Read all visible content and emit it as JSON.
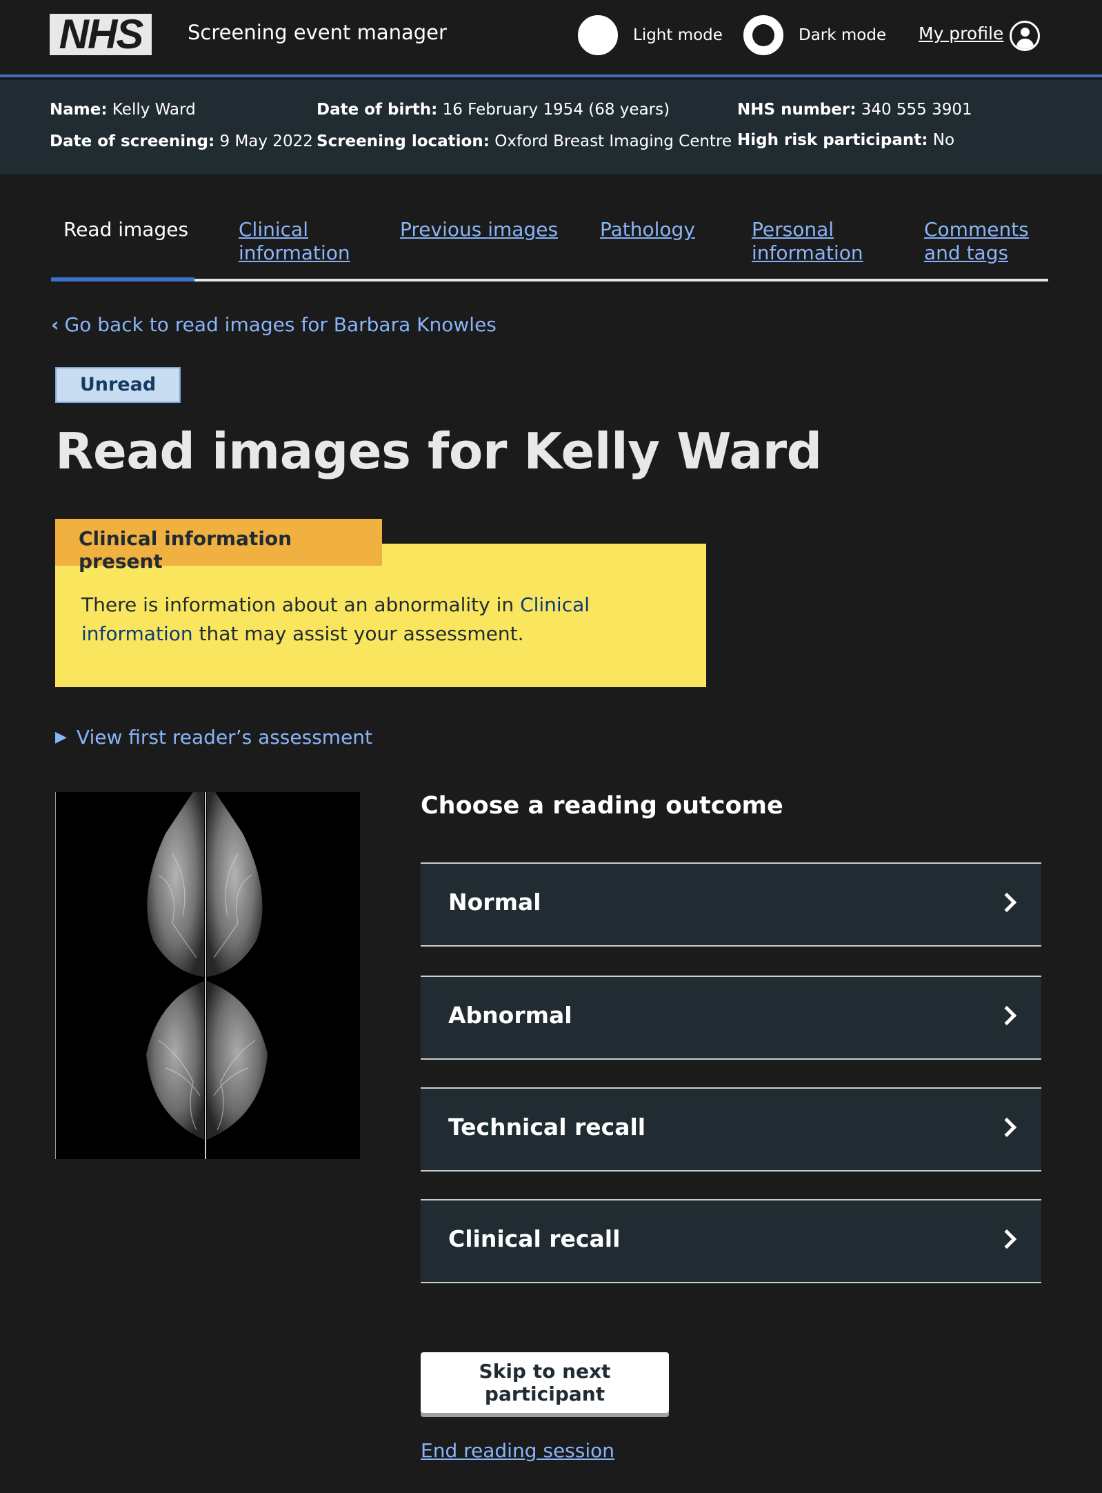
{
  "header": {
    "logo": "NHS",
    "service_name": "Screening event manager",
    "light_mode_label": "Light mode",
    "dark_mode_label": "Dark mode",
    "profile_label": "My profile"
  },
  "participant": {
    "name_label": "Name:",
    "name": "Kelly Ward",
    "screening_date_label": "Date of screening:",
    "screening_date": "9 May 2022",
    "dob_label": "Date of birth:",
    "dob": "16 February 1954 (68 years)",
    "location_label": "Screening location:",
    "location": "Oxford Breast Imaging Centre",
    "nhs_label": "NHS number:",
    "nhs_number": "340 555 3901",
    "risk_label": "High risk participant:",
    "risk": "No"
  },
  "tabs": [
    {
      "label": "Read images",
      "active": true
    },
    {
      "label": "Clinical information"
    },
    {
      "label": "Previous images"
    },
    {
      "label": "Pathology"
    },
    {
      "label": "Personal information"
    },
    {
      "label": "Comments and tags"
    }
  ],
  "back_link": "Go back to read images for Barbara Knowles",
  "status_tag": "Unread",
  "page_title": "Read images for Kelly Ward",
  "callout": {
    "label": "Clinical information present",
    "text_before": "There is information about an abnormality in ",
    "link": "Clinical information",
    "text_after": " that may assist your assessment."
  },
  "details_summary": "View first reader’s assessment",
  "outcome_heading": "Choose a reading outcome",
  "outcomes": [
    "Normal",
    "Abnormal",
    "Technical recall",
    "Clinical recall"
  ],
  "skip_button": "Skip to next participant",
  "end_link": "End reading session",
  "colors": {
    "background": "#1b1b1b",
    "banner": "#212b32",
    "accent_blue": "#3d72c8",
    "link": "#8ab4f8",
    "warning_label": "#f0b140",
    "warning_body": "#f9e55e",
    "tag_bg": "#c8dcf2"
  }
}
